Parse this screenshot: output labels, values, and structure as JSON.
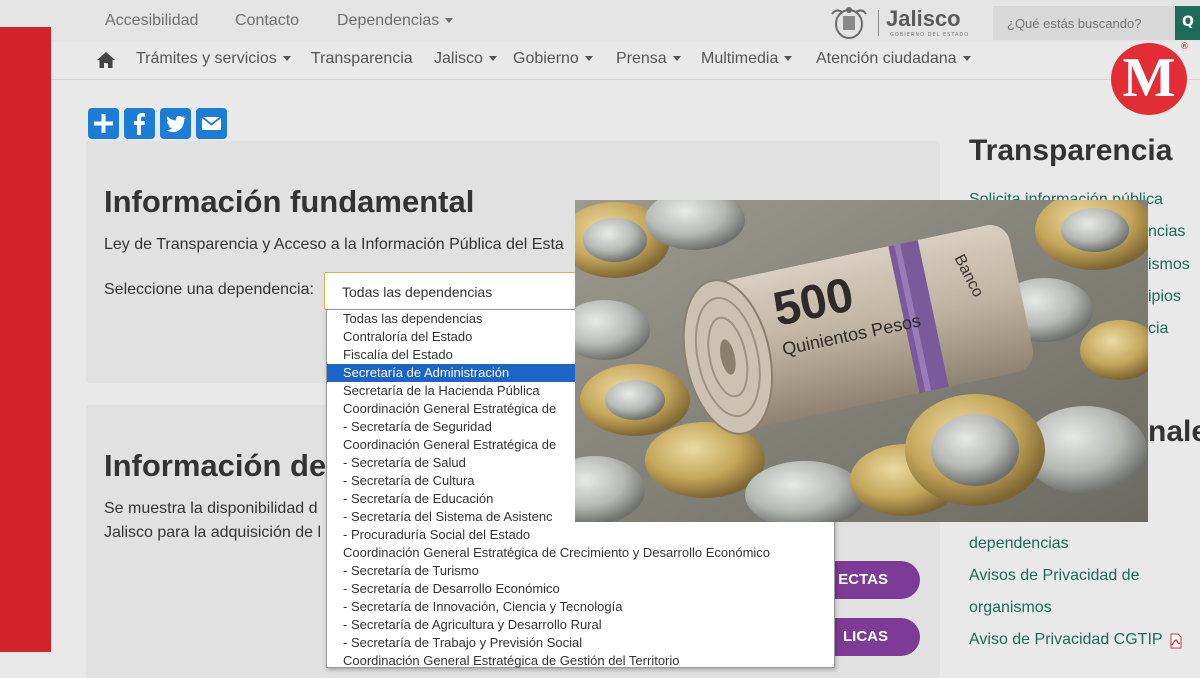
{
  "topbar": {
    "links": [
      {
        "label": "Accesibilidad"
      },
      {
        "label": "Contacto"
      },
      {
        "label": "Dependencias"
      }
    ],
    "brand": {
      "name": "Jalisco",
      "subtitle": "GOBIERNO DEL ESTADO"
    },
    "search": {
      "placeholder": "¿Qué estás buscando?",
      "button": "Q"
    }
  },
  "nav": {
    "items": [
      {
        "label": "Trámites y servicios",
        "dropdown": true
      },
      {
        "label": "Transparencia",
        "dropdown": false
      },
      {
        "label": "Jalisco",
        "dropdown": true
      },
      {
        "label": "Gobierno",
        "dropdown": true
      },
      {
        "label": "Prensa",
        "dropdown": true
      },
      {
        "label": "Multimedia",
        "dropdown": true
      },
      {
        "label": "Atención ciudadana",
        "dropdown": true
      }
    ]
  },
  "milenio": {
    "letter": "M",
    "mark": "®",
    "color": "#e32d36"
  },
  "share": [
    {
      "icon": "plus-icon"
    },
    {
      "icon": "facebook-icon"
    },
    {
      "icon": "twitter-icon"
    },
    {
      "icon": "email-icon"
    }
  ],
  "main": {
    "section1": {
      "title": "Información fundamental",
      "law_text": "Ley de Transparencia y Acceso a la Información Pública del Esta",
      "select_label": "Seleccione una dependencia:",
      "select_value": "Todas las dependencias"
    },
    "section2": {
      "title": "Información de",
      "para_line1": "Se muestra la disponibilidad d",
      "para_line2": "Jalisco para la adquisición de l",
      "button1": "ECTAS",
      "button2": "LICAS"
    }
  },
  "dropdown": {
    "selected_index": 3,
    "options": [
      "Todas las dependencias",
      "Contraloría del Estado",
      "Fiscalía del Estado",
      "Secretaría de Administración",
      "Secretaría de la Hacienda Pública",
      "Coordinación General Estratégica de",
      "- Secretaría de Seguridad",
      "Coordinación General Estratégica de",
      "- Secretaría de Salud",
      "- Secretaría de Cultura",
      "- Secretaría de Educación",
      "- Secretaría del Sistema de Asistenc",
      "- Procuraduría Social del Estado",
      "Coordinación General Estratégica de Crecimiento y Desarrollo Económico",
      "- Secretaría de Turismo",
      "- Secretaría de Desarrollo Económico",
      "- Secretaría de Innovación, Ciencia y Tecnología",
      "- Secretaría de Agricultura y Desarrollo Rural",
      "- Secretaría de Trabajo y Previsión Social",
      "Coordinación General Estratégica de Gestión del Territorio"
    ]
  },
  "sidebar": {
    "title": "Transparencia",
    "links_top": [
      "Solicita información pública",
      "ncias",
      "ismos",
      "ipios",
      "cia"
    ],
    "section_title_fragment": "nale",
    "links_bottom": [
      "dependencias",
      "Avisos de Privacidad de",
      "organismos",
      "Aviso de Privacidad CGTIP"
    ]
  },
  "photo": {
    "banknote_value": "500",
    "banknote_text": "Quinientos Pesos",
    "banknote_bank": "Banco"
  },
  "colors": {
    "accent_red": "#d2232a",
    "link_green": "#1e6b5a",
    "purple": "#7d3a96",
    "share_blue": "#1c7cd6",
    "selected_blue": "#1e64c8"
  }
}
